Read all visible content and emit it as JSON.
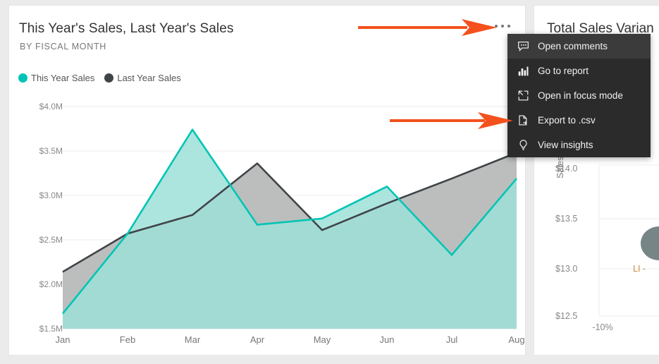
{
  "page": {
    "background_color": "#ebebeb"
  },
  "left_card": {
    "title": "This Year's Sales, Last Year's Sales",
    "subtitle": "BY FISCAL MONTH",
    "ellipsis_label": "More options"
  },
  "right_card": {
    "title": "Total Sales Varian",
    "y_axis_label": "Sales Per Sq F",
    "y_ticks": [
      "$14.0",
      "$13.5",
      "$13.0",
      "$12.5"
    ],
    "x_ticks": [
      "-10%"
    ],
    "point_label": "LI -"
  },
  "legend": {
    "items": [
      {
        "label": "This Year Sales",
        "color": "#00c5b4"
      },
      {
        "label": "Last Year Sales",
        "color": "#3f4448"
      }
    ]
  },
  "context_menu": {
    "items": [
      {
        "label": "Open comments",
        "icon": "comment-icon",
        "hovered": true
      },
      {
        "label": "Go to report",
        "icon": "bar-chart-icon",
        "hovered": false
      },
      {
        "label": "Open in focus mode",
        "icon": "focus-mode-icon",
        "hovered": false
      },
      {
        "label": "Export to .csv",
        "icon": "export-file-icon",
        "hovered": false
      },
      {
        "label": "View insights",
        "icon": "lightbulb-icon",
        "hovered": false
      }
    ]
  },
  "annotations": {
    "arrow_color": "#f4511e",
    "arrows": [
      {
        "name": "arrow-to-ellipsis",
        "target": "More options ellipsis"
      },
      {
        "name": "arrow-to-export-csv",
        "target": "Export to .csv"
      }
    ]
  },
  "chart_data": {
    "type": "area",
    "title": "This Year's Sales, Last Year's Sales",
    "subtitle": "BY FISCAL MONTH",
    "xlabel": "Fiscal Month",
    "ylabel": "",
    "categories": [
      "Jan",
      "Feb",
      "Mar",
      "Apr",
      "May",
      "Jun",
      "Jul",
      "Aug"
    ],
    "ylim": [
      1.5,
      4.0
    ],
    "ytick_values": [
      4.0,
      3.5,
      3.0,
      2.5,
      2.0,
      1.5
    ],
    "ytick_labels": [
      "$4.0M",
      "$3.5M",
      "$3.0M",
      "$2.5M",
      "$2.0M",
      "$1.5M"
    ],
    "grid": true,
    "legend_position": "top-left",
    "units": "millions of dollars",
    "series": [
      {
        "name": "This Year Sales",
        "stroke": "#00c5b4",
        "fill": "#9ee0d8",
        "values": [
          1.67,
          2.57,
          3.74,
          2.67,
          2.74,
          3.1,
          2.33,
          3.19
        ]
      },
      {
        "name": "Last Year Sales",
        "stroke": "#3f4448",
        "fill": "#b8bbbb",
        "values": [
          2.14,
          2.57,
          2.78,
          3.36,
          2.61,
          2.91,
          3.19,
          3.48
        ]
      }
    ],
    "overlap_fill": "#68a39c"
  },
  "right_chart_data": {
    "type": "scatter",
    "title": "Total Sales Varian",
    "xlabel": "",
    "ylabel": "Sales Per Sq F",
    "ytick_labels": [
      "$14.0",
      "$13.5",
      "$13.0",
      "$12.5"
    ],
    "ytick_values": [
      14.0,
      13.5,
      13.0,
      12.5
    ],
    "xtick_labels": [
      "-10%"
    ],
    "points": [
      {
        "label": "LI -",
        "x": -0.085,
        "y": 13.25,
        "color": "#6b7b7d"
      }
    ]
  }
}
